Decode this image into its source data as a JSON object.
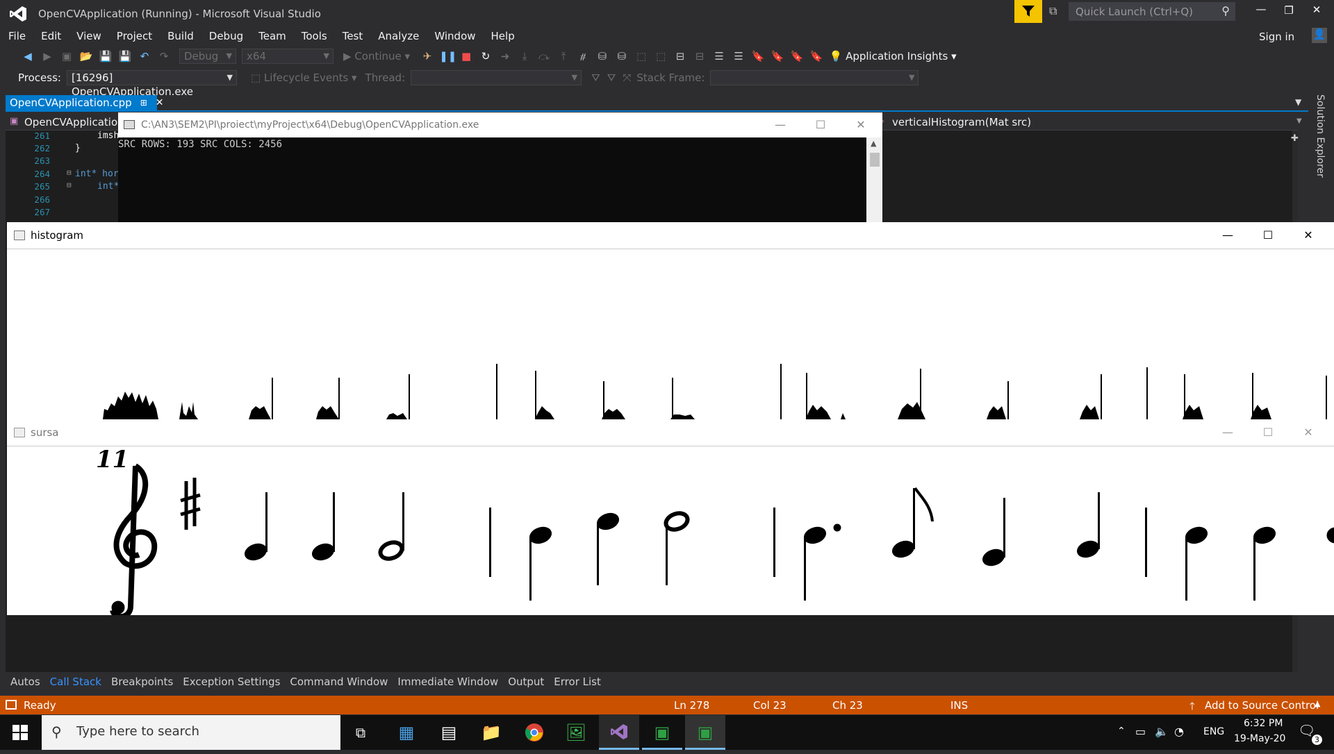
{
  "window_title": "OpenCVApplication (Running) - Microsoft Visual Studio",
  "quick_launch_placeholder": "Quick Launch (Ctrl+Q)",
  "sign_in": "Sign in",
  "menu": [
    "File",
    "Edit",
    "View",
    "Project",
    "Build",
    "Debug",
    "Team",
    "Tools",
    "Test",
    "Analyze",
    "Window",
    "Help"
  ],
  "toolbar": {
    "config": "Debug",
    "platform": "x64",
    "continue": "Continue",
    "app_insights": "Application Insights"
  },
  "debugbar": {
    "process_label": "Process:",
    "process_value": "[16296] OpenCVApplication.exe",
    "lifecycle": "Lifecycle Events",
    "thread_label": "Thread:",
    "stack_label": "Stack Frame:"
  },
  "doc_tab": "OpenCVApplication.cpp",
  "nav": {
    "project": "OpenCVApplication",
    "member": "verticalHistogram(Mat src)"
  },
  "code_lines": [
    {
      "n": "261",
      "t": "imsh"
    },
    {
      "n": "262",
      "t": "}"
    },
    {
      "n": "263",
      "t": ""
    },
    {
      "n": "264",
      "t": "int* hor"
    },
    {
      "n": "265",
      "t": "int*"
    },
    {
      "n": "266",
      "t": ""
    },
    {
      "n": "267",
      "t": ""
    }
  ],
  "console": {
    "title": "C:\\AN3\\SEM2\\PI\\proiect\\myProject\\x64\\Debug\\OpenCVApplication.exe",
    "output": "SRC ROWS: 193 SRC COLS: 2456"
  },
  "histogram_window": {
    "title": "histogram"
  },
  "sursa_window": {
    "title": "sursa",
    "staff_number": "11"
  },
  "side_panel": "Solution Explorer",
  "tool_tabs": [
    "Autos",
    "Call Stack",
    "Breakpoints",
    "Exception Settings",
    "Command Window",
    "Immediate Window",
    "Output",
    "Error List"
  ],
  "active_tool_tab": "Call Stack",
  "status": {
    "ready": "Ready",
    "ln": "Ln 278",
    "col": "Col 23",
    "ch": "Ch 23",
    "ins": "INS",
    "source_control": "Add to Source Control"
  },
  "taskbar": {
    "search_placeholder": "Type here to search",
    "lang": "ENG",
    "time": "6:32 PM",
    "date": "19-May-20",
    "notif_count": "3"
  },
  "colors": {
    "accent": "#007acc",
    "status": "#ca5100",
    "filter": "#f5c400"
  }
}
